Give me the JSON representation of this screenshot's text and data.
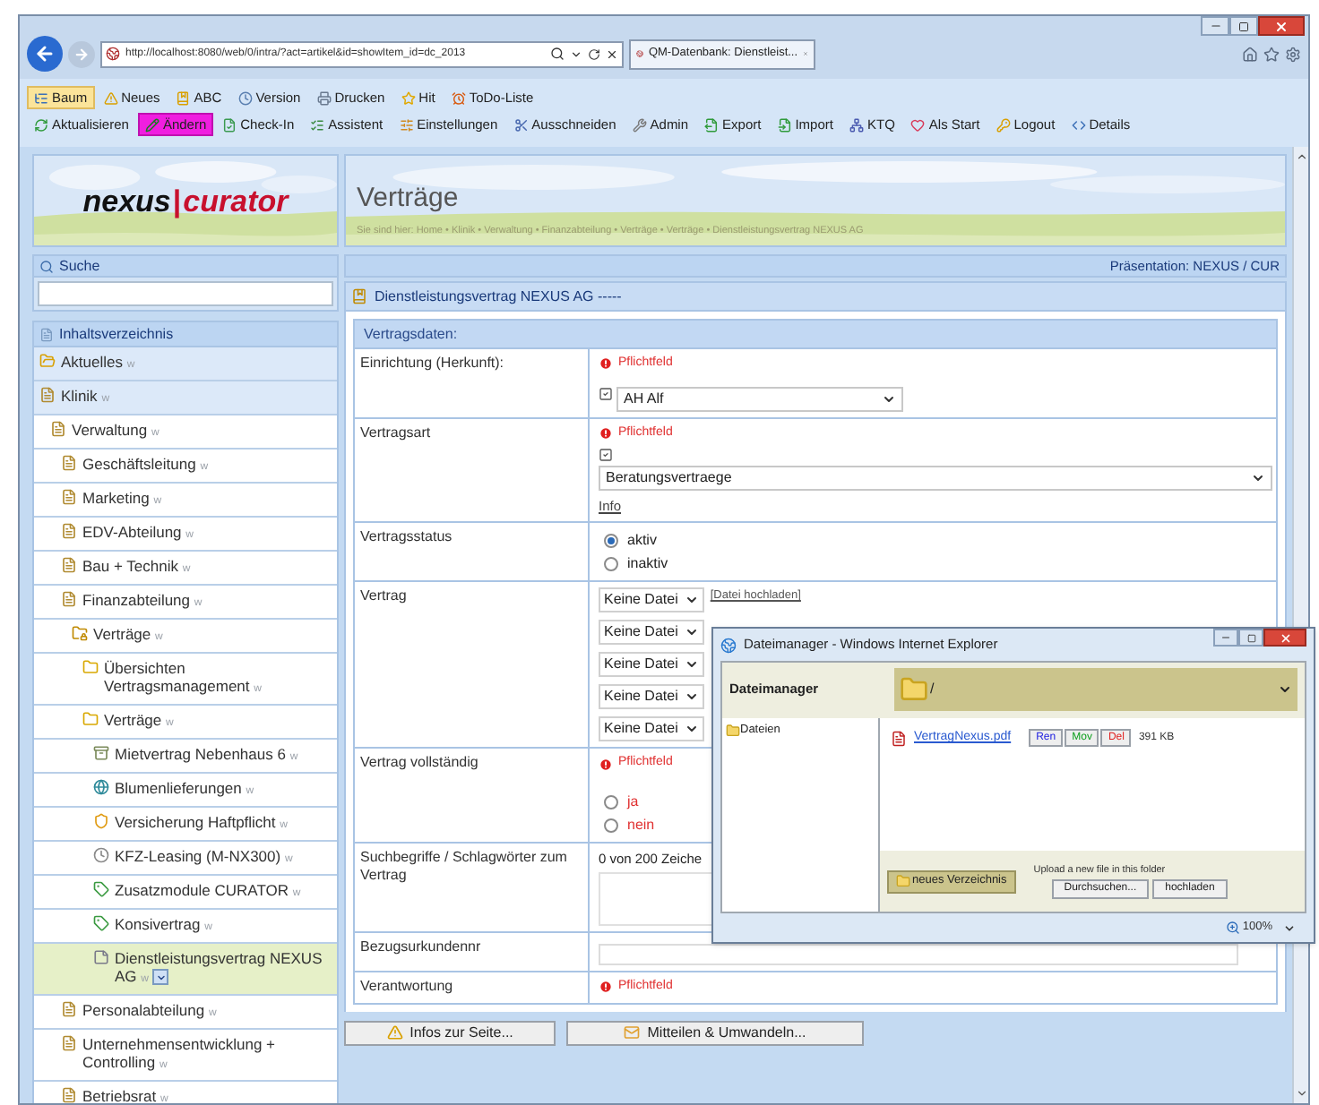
{
  "browser": {
    "url": "http://localhost:8080/web/0/intra/?act=artikel&id=showItem_id=dc_2013",
    "tab": "QM-Datenbank: Dienstleist..."
  },
  "toolbars": [
    {
      "items": [
        {
          "label": "Baum",
          "selected": true
        },
        {
          "label": "Neues",
          "selected": false
        },
        {
          "label": "ABC",
          "selected": false
        },
        {
          "label": "Version",
          "selected": false
        },
        {
          "label": "Drucken",
          "selected": false
        },
        {
          "label": "Hit",
          "selected": false
        },
        {
          "label": "ToDo-Liste",
          "selected": false
        }
      ]
    },
    {
      "items": [
        {
          "label": "Aktualisieren",
          "selected": false
        },
        {
          "label": "Ändern",
          "selected": true
        },
        {
          "label": "Check-In",
          "selected": false
        },
        {
          "label": "Assistent",
          "selected": false
        },
        {
          "label": "Einstellungen",
          "selected": false
        },
        {
          "label": "Ausschneiden",
          "selected": false
        },
        {
          "label": "Admin",
          "selected": false
        },
        {
          "label": "Export",
          "selected": false
        },
        {
          "label": "Import",
          "selected": false
        },
        {
          "label": "KTQ",
          "selected": false
        },
        {
          "label": "Als Start",
          "selected": false
        },
        {
          "label": "Logout",
          "selected": false
        },
        {
          "label": "Details",
          "selected": false
        }
      ]
    }
  ],
  "logo": {
    "left": "nexus",
    "separator": "|",
    "right": "curator"
  },
  "search": {
    "title": "Suche"
  },
  "header": {
    "title": "Verträge",
    "breadcrumb": "Sie sind hier: Home • Klinik • Verwaltung • Finanzabteilung • Verträge • Verträge • Dienstleistungsvertrag NEXUS AG"
  },
  "presentation": "Präsentation: NEXUS / CUR",
  "document": {
    "title": "Dienstleistungsvertrag NEXUS AG -----"
  },
  "toc": {
    "title": "Inhaltsverzeichnis",
    "items": [
      {
        "label": "Aktuelles",
        "suffix": "w",
        "kind": "alert-folder",
        "selected": false
      },
      {
        "label": "Klinik",
        "suffix": "w",
        "kind": "page",
        "selected": false,
        "children": [
          {
            "label": "Verwaltung",
            "suffix": "w",
            "kind": "page",
            "selected": false,
            "children": [
              {
                "label": "Geschäftsleitung",
                "suffix": "w",
                "kind": "page",
                "selected": false
              },
              {
                "label": "Marketing",
                "suffix": "w",
                "kind": "page",
                "selected": false
              },
              {
                "label": "EDV-Abteilung",
                "suffix": "w",
                "kind": "page",
                "selected": false
              },
              {
                "label": "Bau + Technik",
                "suffix": "w",
                "kind": "page",
                "selected": false
              },
              {
                "label": "Finanzabteilung",
                "suffix": "w",
                "kind": "page",
                "selected": false,
                "children": [
                  {
                    "label": "Verträge",
                    "suffix": "w",
                    "kind": "lock-folder",
                    "selected": false,
                    "children": [
                      {
                        "label": "Übersichten Vertragsmanagement",
                        "suffix": "w",
                        "kind": "folder",
                        "selected": false
                      },
                      {
                        "label": "Verträge",
                        "suffix": "w",
                        "kind": "folder",
                        "selected": false,
                        "children": [
                          {
                            "label": "Mietvertrag Nebenhaus 6",
                            "suffix": "w",
                            "kind": "archive",
                            "selected": false
                          },
                          {
                            "label": "Blumenlieferungen",
                            "suffix": "w",
                            "kind": "globe",
                            "selected": false
                          },
                          {
                            "label": "Versicherung Haftpflicht",
                            "suffix": "w",
                            "kind": "shield",
                            "selected": false
                          },
                          {
                            "label": "KFZ-Leasing (M-NX300)",
                            "suffix": "w",
                            "kind": "clock",
                            "selected": false
                          },
                          {
                            "label": "Zusatzmodule CURATOR",
                            "suffix": "w",
                            "kind": "tag",
                            "selected": false
                          },
                          {
                            "label": "Konsivertrag",
                            "suffix": "w",
                            "kind": "tag",
                            "selected": false
                          },
                          {
                            "label": "Dienstleistungsvertrag NEXUS AG",
                            "suffix": "w",
                            "kind": "note",
                            "selected": true
                          }
                        ]
                      }
                    ]
                  }
                ]
              },
              {
                "label": "Personalabteilung",
                "suffix": "w",
                "kind": "page",
                "selected": false
              },
              {
                "label": "Unternehmensentwicklung + Controlling",
                "suffix": "w",
                "kind": "page",
                "selected": false
              },
              {
                "label": "Betriebsrat",
                "suffix": "w",
                "kind": "page",
                "selected": false
              }
            ]
          }
        ]
      }
    ]
  },
  "form": {
    "section": "Vertragsdaten:",
    "fields": [
      {
        "kind": "select",
        "label": "Einrichtung (Herkunft):",
        "note": "Pflichtfeld",
        "value": "AH Alf",
        "wide": false
      },
      {
        "kind": "select",
        "label": "Vertragsart",
        "note": "Pflichtfeld",
        "value": "Beratungsvertraege",
        "wide": true,
        "link": "Info"
      },
      {
        "kind": "radio",
        "label": "Vertragsstatus",
        "invalid": false,
        "options": [
          {
            "label": "aktiv",
            "selected": true
          },
          {
            "label": "inaktiv",
            "selected": false
          }
        ]
      },
      {
        "kind": "files",
        "label": "Vertrag",
        "link": "[Datei hochladen]",
        "files": [
          "Keine Datei",
          "Keine Datei",
          "Keine Datei",
          "Keine Datei",
          "Keine Datei"
        ]
      },
      {
        "kind": "radio",
        "label": "Vertrag vollständig",
        "note": "Pflichtfeld",
        "invalid": true,
        "options": [
          {
            "label": "ja",
            "selected": false
          },
          {
            "label": "nein",
            "selected": false
          }
        ]
      },
      {
        "kind": "textarea",
        "label": "Suchbegriffe / Schlagwörter zum Vertrag",
        "counter": "0 von 200 Zeiche"
      },
      {
        "kind": "text",
        "label": "Bezugsurkundennr"
      },
      {
        "kind": "note",
        "label": "Verantwortung",
        "note": "Pflichtfeld"
      }
    ]
  },
  "footer_buttons": [
    {
      "label": "Infos zur Seite..."
    },
    {
      "label": "Mitteilen & Umwandeln..."
    }
  ],
  "file_manager": {
    "title": "Dateimanager - Windows Internet Explorer",
    "heading": "Dateimanager",
    "path": "/",
    "folders": [
      "Dateien"
    ],
    "files": [
      {
        "name": "VertragNexus.pdf",
        "actions": [
          "Ren",
          "Mov",
          "Del"
        ],
        "size": "391 KB"
      }
    ],
    "new_folder": "neues Verzeichnis",
    "upload_hint": "Upload a new file in this folder",
    "browse": "Durchsuchen...",
    "upload": "hochladen",
    "zoom": "100%"
  }
}
